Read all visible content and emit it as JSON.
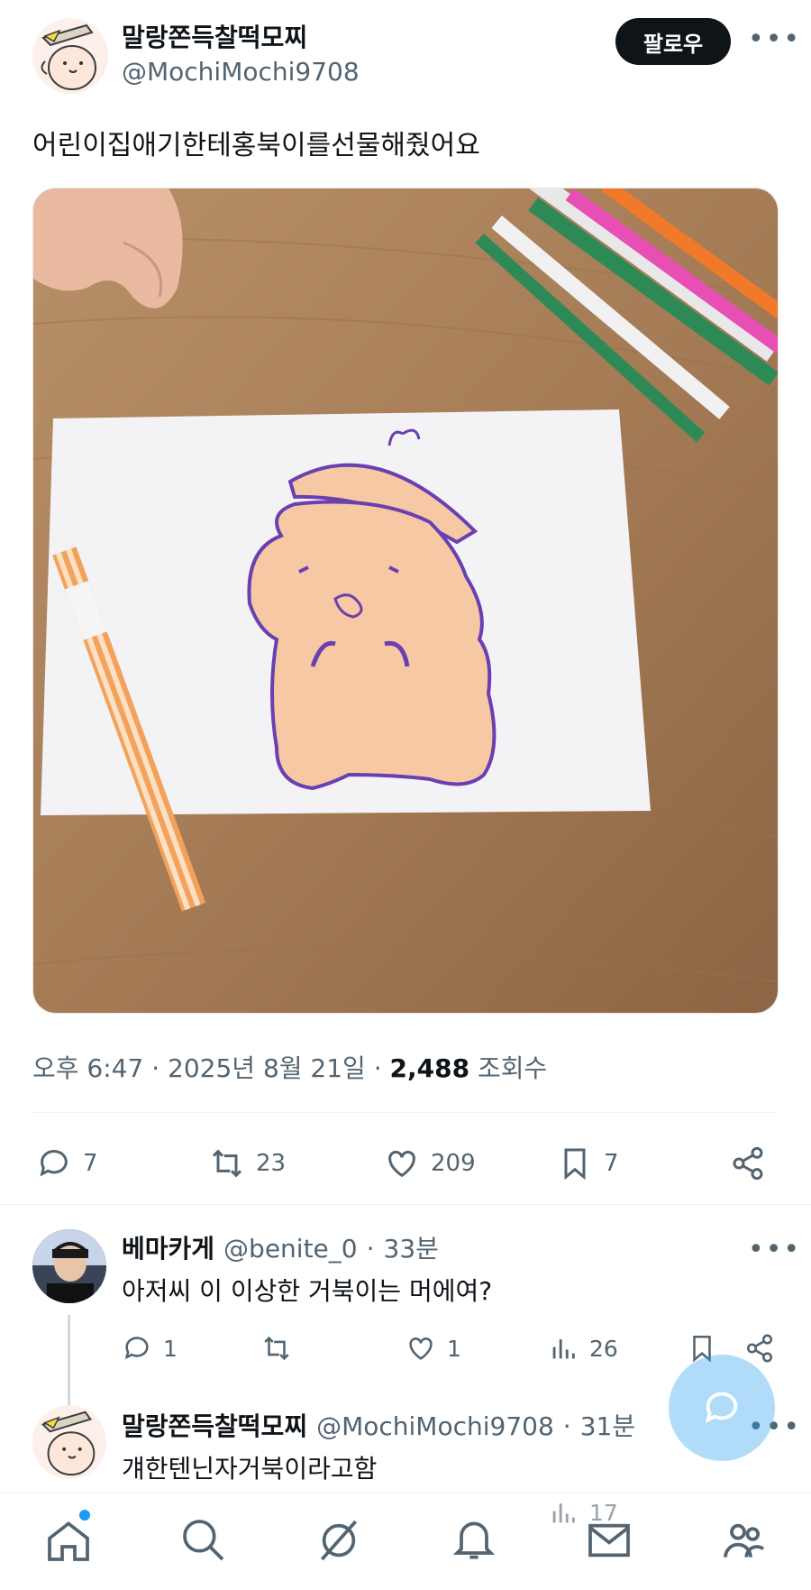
{
  "post": {
    "display_name": "말랑쫀득찰떡모찌",
    "handle": "@MochiMochi9708",
    "follow_label": "팔로우",
    "more": "•••",
    "text": "어린이집애기한테홍북이를선물해줬어요",
    "time": "오후 6:47",
    "date": "2025년 8월 21일",
    "views": "2,488",
    "views_label": "조회수",
    "sep": "·"
  },
  "actions": {
    "replies": "7",
    "reposts": "23",
    "likes": "209",
    "bookmarks": "7"
  },
  "replies": [
    {
      "name": "베마카게",
      "handle": "@benite_0",
      "time": "33분",
      "text": "아저씨 이 이상한 거북이는 머에여?",
      "replies": "1",
      "reposts": "",
      "likes": "1",
      "views": "26"
    },
    {
      "name": "말랑쫀득찰떡모찌",
      "handle": "@MochiMochi9708",
      "time": "31분",
      "text": "걔한텐닌자거북이라고함",
      "views": "17"
    }
  ],
  "colors": {
    "accent": "#1d9bf0",
    "text": "#0f1419",
    "muted": "#536471",
    "drawing_outline": "#6a3fb0",
    "drawing_fill": "#f6c9a4"
  },
  "icons": [
    "mochi-avatar",
    "reply-icon",
    "repost-icon",
    "like-icon",
    "bookmark-icon",
    "share-icon",
    "views-icon",
    "compose-icon",
    "home-icon",
    "search-icon",
    "grok-icon",
    "notifications-icon",
    "messages-icon",
    "communities-icon"
  ]
}
